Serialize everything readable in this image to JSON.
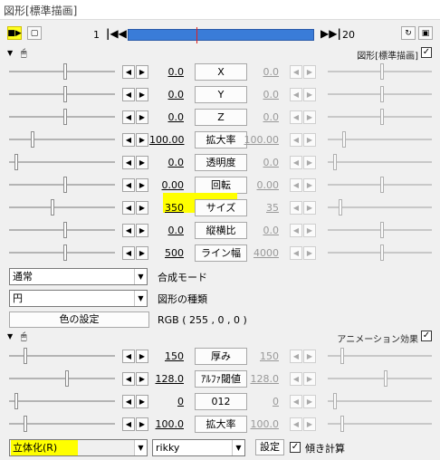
{
  "window": {
    "title": "図形[標準描画]"
  },
  "toolbar": {
    "frame_start": "1",
    "frame_end": "20",
    "prev_icon": "jump-start-icon",
    "next_icon": "jump-end-icon"
  },
  "section1": {
    "label": "図形[標準描画]",
    "enabled": "✓"
  },
  "params1": [
    {
      "name": "X",
      "left": "0.0",
      "right": "0.0"
    },
    {
      "name": "Y",
      "left": "0.0",
      "right": "0.0"
    },
    {
      "name": "Z",
      "left": "0.0",
      "right": "0.0"
    },
    {
      "name": "拡大率",
      "left": "100.00",
      "right": "100.00"
    },
    {
      "name": "透明度",
      "left": "0.0",
      "right": "0.0"
    },
    {
      "name": "回転",
      "left": "0.00",
      "right": "0.00"
    },
    {
      "name": "サイズ",
      "left": "350",
      "right": "35"
    },
    {
      "name": "縦横比",
      "left": "0.0",
      "right": "0.0"
    },
    {
      "name": "ライン幅",
      "left": "500",
      "right": "4000"
    }
  ],
  "blend": {
    "value": "通常",
    "label": "合成モード"
  },
  "shape": {
    "value": "円",
    "label": "図形の種類"
  },
  "color": {
    "button": "色の設定",
    "value": "RGB ( 255 , 0 , 0 )"
  },
  "section2": {
    "label": "アニメーション効果",
    "enabled": "✓"
  },
  "params2": [
    {
      "name": "厚み",
      "left": "150",
      "right": "150"
    },
    {
      "name": "ｱﾙﾌｧ閾値",
      "left": "128.0",
      "right": "128.0"
    },
    {
      "name": "012",
      "left": "0",
      "right": "0"
    },
    {
      "name": "拡大率",
      "left": "100.0",
      "right": "100.0"
    }
  ],
  "effect": {
    "name": "立体化(R)",
    "script": "rikky",
    "settings_button": "設定",
    "tilt_checked": "✓",
    "tilt_label": "傾き計算"
  },
  "colors": {
    "highlight": "#ffff00",
    "timeline": "#3a7cd8",
    "cursor": "#e02020"
  }
}
